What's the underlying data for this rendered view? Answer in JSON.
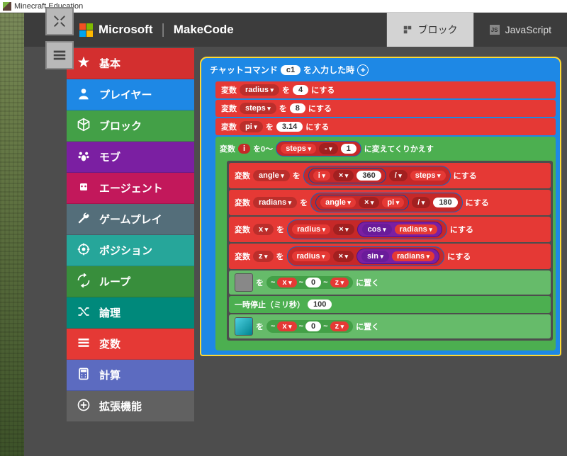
{
  "window": {
    "title": "Minecraft Education"
  },
  "header": {
    "microsoft": "Microsoft",
    "makecode": "MakeCode",
    "tab_blocks": "ブロック",
    "tab_js": "JavaScript"
  },
  "categories": [
    {
      "label": "基本",
      "color": "#d32f2f",
      "icon": "star"
    },
    {
      "label": "プレイヤー",
      "color": "#1e88e5",
      "icon": "person"
    },
    {
      "label": "ブロック",
      "color": "#43a047",
      "icon": "cube"
    },
    {
      "label": "モブ",
      "color": "#7b1fa2",
      "icon": "paw"
    },
    {
      "label": "エージェント",
      "color": "#c2185b",
      "icon": "robot"
    },
    {
      "label": "ゲームプレイ",
      "color": "#546e7a",
      "icon": "wrench"
    },
    {
      "label": "ポジション",
      "color": "#26a69a",
      "icon": "target"
    },
    {
      "label": "ループ",
      "color": "#388e3c",
      "icon": "loop"
    },
    {
      "label": "論理",
      "color": "#00897b",
      "icon": "shuffle"
    },
    {
      "label": "変数",
      "color": "#e53935",
      "icon": "list"
    },
    {
      "label": "計算",
      "color": "#5c6bc0",
      "icon": "calc"
    },
    {
      "label": "拡張機能",
      "color": "#616161",
      "icon": "plus"
    }
  ],
  "code": {
    "chat_cmd_prefix": "チャットコマンド",
    "chat_cmd_value": "c1",
    "chat_cmd_suffix": "を入力した時",
    "set_var": "変数",
    "wo": "を",
    "nisuru": "にする",
    "radius": "radius",
    "radius_val": "4",
    "steps": "steps",
    "steps_val": "8",
    "pi": "pi",
    "pi_val": "3.14",
    "loop_i": "i",
    "loop_text1": "を0～",
    "loop_text2": "に変えてくりかえす",
    "minus": "-",
    "one": "1",
    "angle": "angle",
    "times": "×",
    "div": "/",
    "n360": "360",
    "radians": "radians",
    "n180": "180",
    "x": "x",
    "cos": "cos",
    "z": "z",
    "sin": "sin",
    "place_wo": "を",
    "place_at": "に置く",
    "zero": "0",
    "neg": "~",
    "pause_label": "一時停止（ミリ秒）",
    "pause_val": "100"
  }
}
